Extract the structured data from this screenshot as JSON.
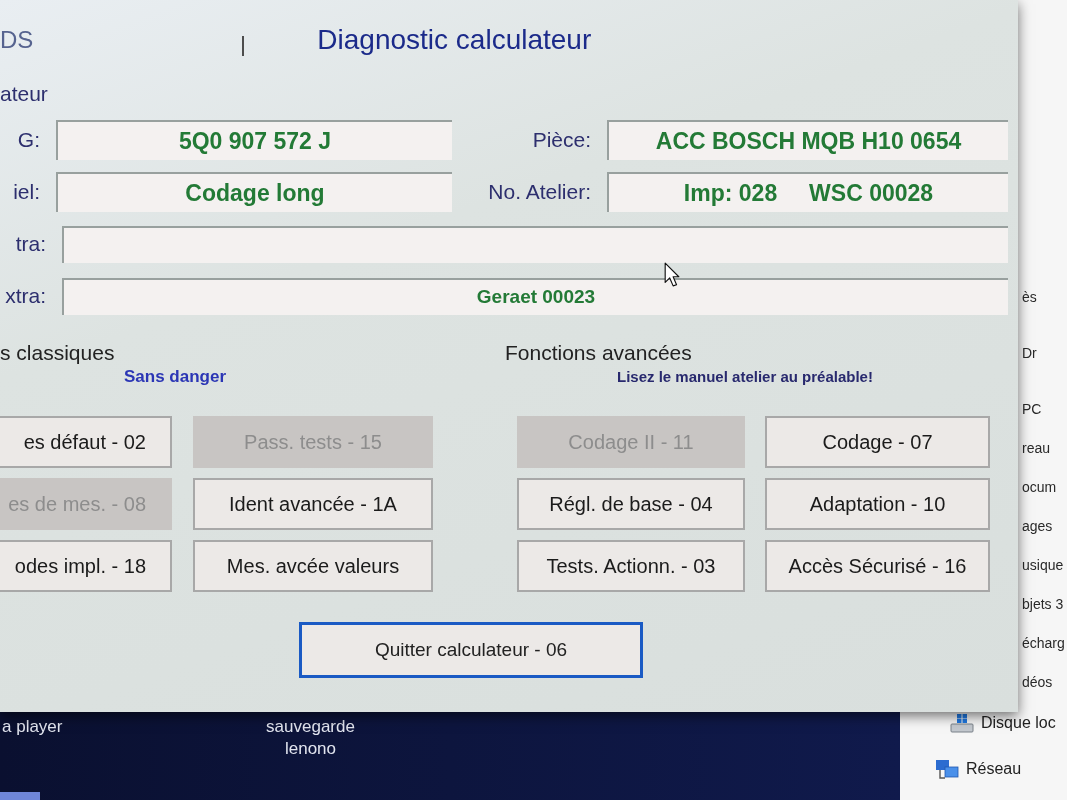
{
  "window": {
    "app_name": "DS",
    "title": "Diagnostic calculateur"
  },
  "group_label": "ateur",
  "info_rows": [
    {
      "fields": [
        {
          "label": "G:",
          "value": "5Q0 907 572 J"
        },
        {
          "label": "Pièce:",
          "value": "ACC BOSCH MQB H10 0654"
        }
      ]
    },
    {
      "fields": [
        {
          "label": "iel:",
          "value": "Codage long"
        },
        {
          "label": "No. Atelier:",
          "value": "Imp: 028     WSC 00028"
        }
      ]
    },
    {
      "fields": [
        {
          "label": "tra:"
        }
      ]
    },
    {
      "fields": [
        {
          "label": "xtra:",
          "value": "Geraet 00023"
        }
      ]
    }
  ],
  "basic_functions": {
    "title": "s classiques",
    "note": "Sans danger",
    "buttons": [
      {
        "label": "es défaut - 02",
        "disabled": false
      },
      {
        "label": "Pass. tests - 15",
        "disabled": true
      },
      {
        "label": "es de mes. - 08",
        "disabled": true
      },
      {
        "label": "Ident avancée - 1A",
        "disabled": false
      },
      {
        "label": "odes impl. - 18",
        "disabled": false
      },
      {
        "label": "Mes. avcée valeurs",
        "disabled": false
      }
    ]
  },
  "advanced_functions": {
    "title": "Fonctions avancées",
    "note": "Lisez le manuel atelier au préalable!",
    "buttons": [
      {
        "label": "Codage II - 11",
        "disabled": true
      },
      {
        "label": "Codage - 07",
        "disabled": false
      },
      {
        "label": "Régl. de base - 04",
        "disabled": false
      },
      {
        "label": "Adaptation - 10",
        "disabled": false
      },
      {
        "label": "Tests. Actionn. - 03",
        "disabled": false
      },
      {
        "label": "Accès Sécurisé - 16",
        "disabled": false
      }
    ]
  },
  "quit_button": {
    "label": "Quitter calculateur - 06",
    "focused": true
  },
  "desktop": {
    "icons": [
      {
        "label": "a player"
      },
      {
        "label": "sauvegarde lenono"
      }
    ]
  },
  "explorer": {
    "cut_items": [
      "ès",
      "Dr",
      "PC",
      "reau",
      "ocum",
      "ages",
      "usique",
      "bjets 3",
      "écharg",
      "déos"
    ],
    "items": [
      {
        "label": "Disque loc",
        "kind": "drive"
      },
      {
        "label": "Réseau",
        "kind": "network"
      }
    ]
  }
}
